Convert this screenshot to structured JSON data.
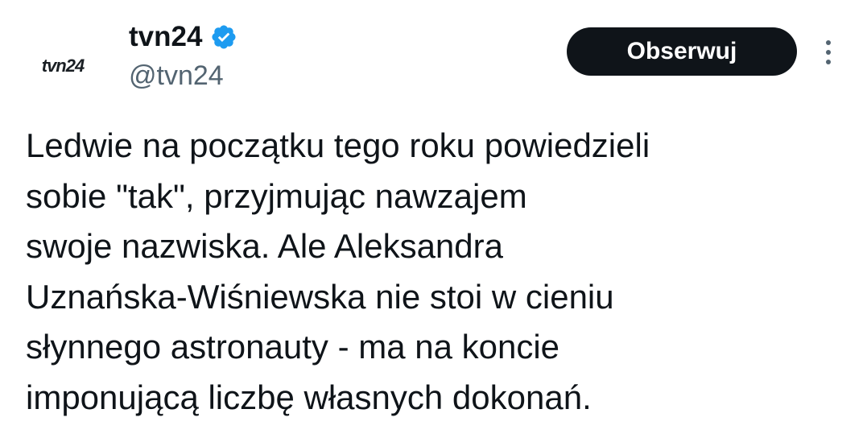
{
  "author": {
    "avatar_text": "tvn24",
    "display_name": "tvn24",
    "handle": "@tvn24",
    "verified_icon": "verified-badge-icon",
    "verified_color": "#1d9bf0"
  },
  "actions": {
    "follow_label": "Obserwuj",
    "more_icon": "more-vertical-icon"
  },
  "tweet": {
    "lines": [
      "Ledwie na początku tego roku powiedzieli",
      "sobie \"tak\", przyjmując nawzajem",
      "swoje nazwiska. Ale Aleksandra",
      "Uznańska-Wiśniewska nie stoi w cieniu",
      "słynnego astronauty - ma na koncie",
      "imponującą liczbę własnych dokonań."
    ]
  },
  "colors": {
    "text_primary": "#0f1419",
    "text_secondary": "#536471",
    "button_bg": "#0f1419",
    "button_text": "#ffffff"
  }
}
